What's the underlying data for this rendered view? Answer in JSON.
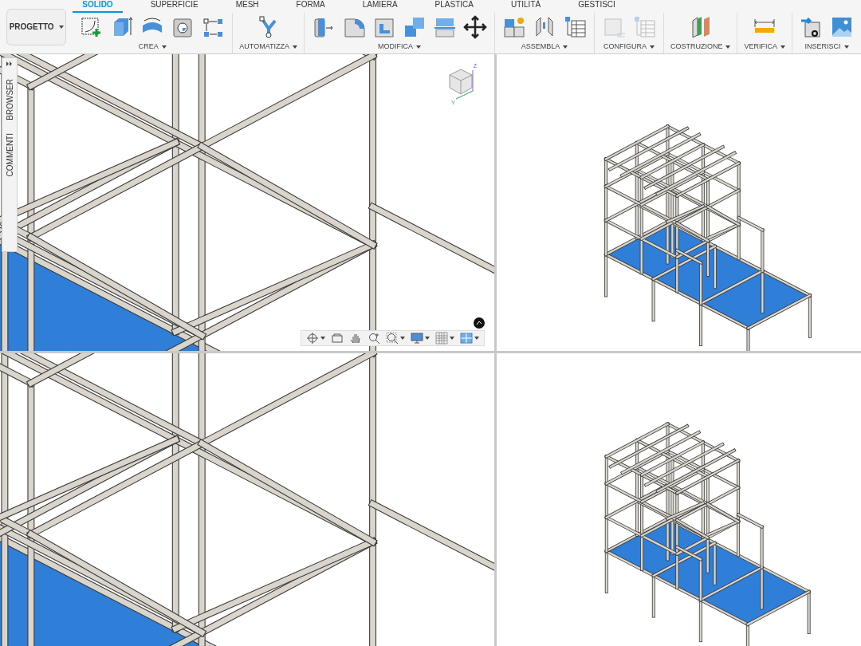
{
  "project_button": {
    "label": "PROGETTO"
  },
  "tabs": [
    {
      "label": "SOLIDO",
      "selected": true
    },
    {
      "label": "SUPERFICIE",
      "selected": false
    },
    {
      "label": "MESH",
      "selected": false
    },
    {
      "label": "FORMA",
      "selected": false
    },
    {
      "label": "LAMIERA",
      "selected": false
    },
    {
      "label": "PLASTICA",
      "selected": false
    },
    {
      "label": "UTILITÀ",
      "selected": false
    },
    {
      "label": "GESTISCI",
      "selected": false
    }
  ],
  "groups": [
    {
      "label": "CREA",
      "tools": [
        {
          "kind": "sketch",
          "disabled": false
        },
        {
          "kind": "extrude",
          "disabled": false
        },
        {
          "kind": "revolve",
          "disabled": false
        },
        {
          "kind": "hole",
          "disabled": false
        },
        {
          "kind": "pattern",
          "disabled": false
        }
      ]
    },
    {
      "label": "AUTOMATIZZA",
      "tools": [
        {
          "kind": "automate",
          "disabled": false
        }
      ]
    },
    {
      "label": "MODIFICA",
      "tools": [
        {
          "kind": "presspull",
          "disabled": false
        },
        {
          "kind": "fillet",
          "disabled": false
        },
        {
          "kind": "shell",
          "disabled": false
        },
        {
          "kind": "combine",
          "disabled": false
        },
        {
          "kind": "split",
          "disabled": false
        },
        {
          "kind": "move",
          "disabled": false
        }
      ]
    },
    {
      "label": "ASSEMBLA",
      "tools": [
        {
          "kind": "component",
          "disabled": false
        },
        {
          "kind": "joint",
          "disabled": false
        },
        {
          "kind": "table",
          "disabled": false
        }
      ]
    },
    {
      "label": "CONFIGURA",
      "tools": [
        {
          "kind": "cube",
          "disabled": true
        },
        {
          "kind": "table",
          "disabled": true
        }
      ]
    },
    {
      "label": "COSTRUZIONE",
      "tools": [
        {
          "kind": "plane",
          "disabled": false
        }
      ]
    },
    {
      "label": "VERIFICA",
      "tools": [
        {
          "kind": "measure",
          "disabled": false
        }
      ]
    },
    {
      "label": "INSERISCI",
      "tools": [
        {
          "kind": "link",
          "disabled": false
        },
        {
          "kind": "image",
          "disabled": false
        }
      ]
    }
  ],
  "side_panel": {
    "tabs": [
      "BROWSER",
      "COMMENTI"
    ]
  },
  "viewcube": {
    "axes": [
      "Z",
      "Y"
    ]
  },
  "nav_tools": [
    {
      "kind": "orbit",
      "menu": true
    },
    {
      "kind": "look",
      "menu": false
    },
    {
      "kind": "pan",
      "menu": false
    },
    {
      "kind": "zoom",
      "menu": false
    },
    {
      "kind": "fit",
      "menu": true
    },
    {
      "kind": "display",
      "menu": true
    },
    {
      "kind": "grid",
      "menu": true
    },
    {
      "kind": "viewports",
      "menu": true
    }
  ],
  "viewports": [
    {
      "kind": "close"
    },
    {
      "kind": "overview"
    },
    {
      "kind": "close"
    },
    {
      "kind": "overview"
    }
  ]
}
